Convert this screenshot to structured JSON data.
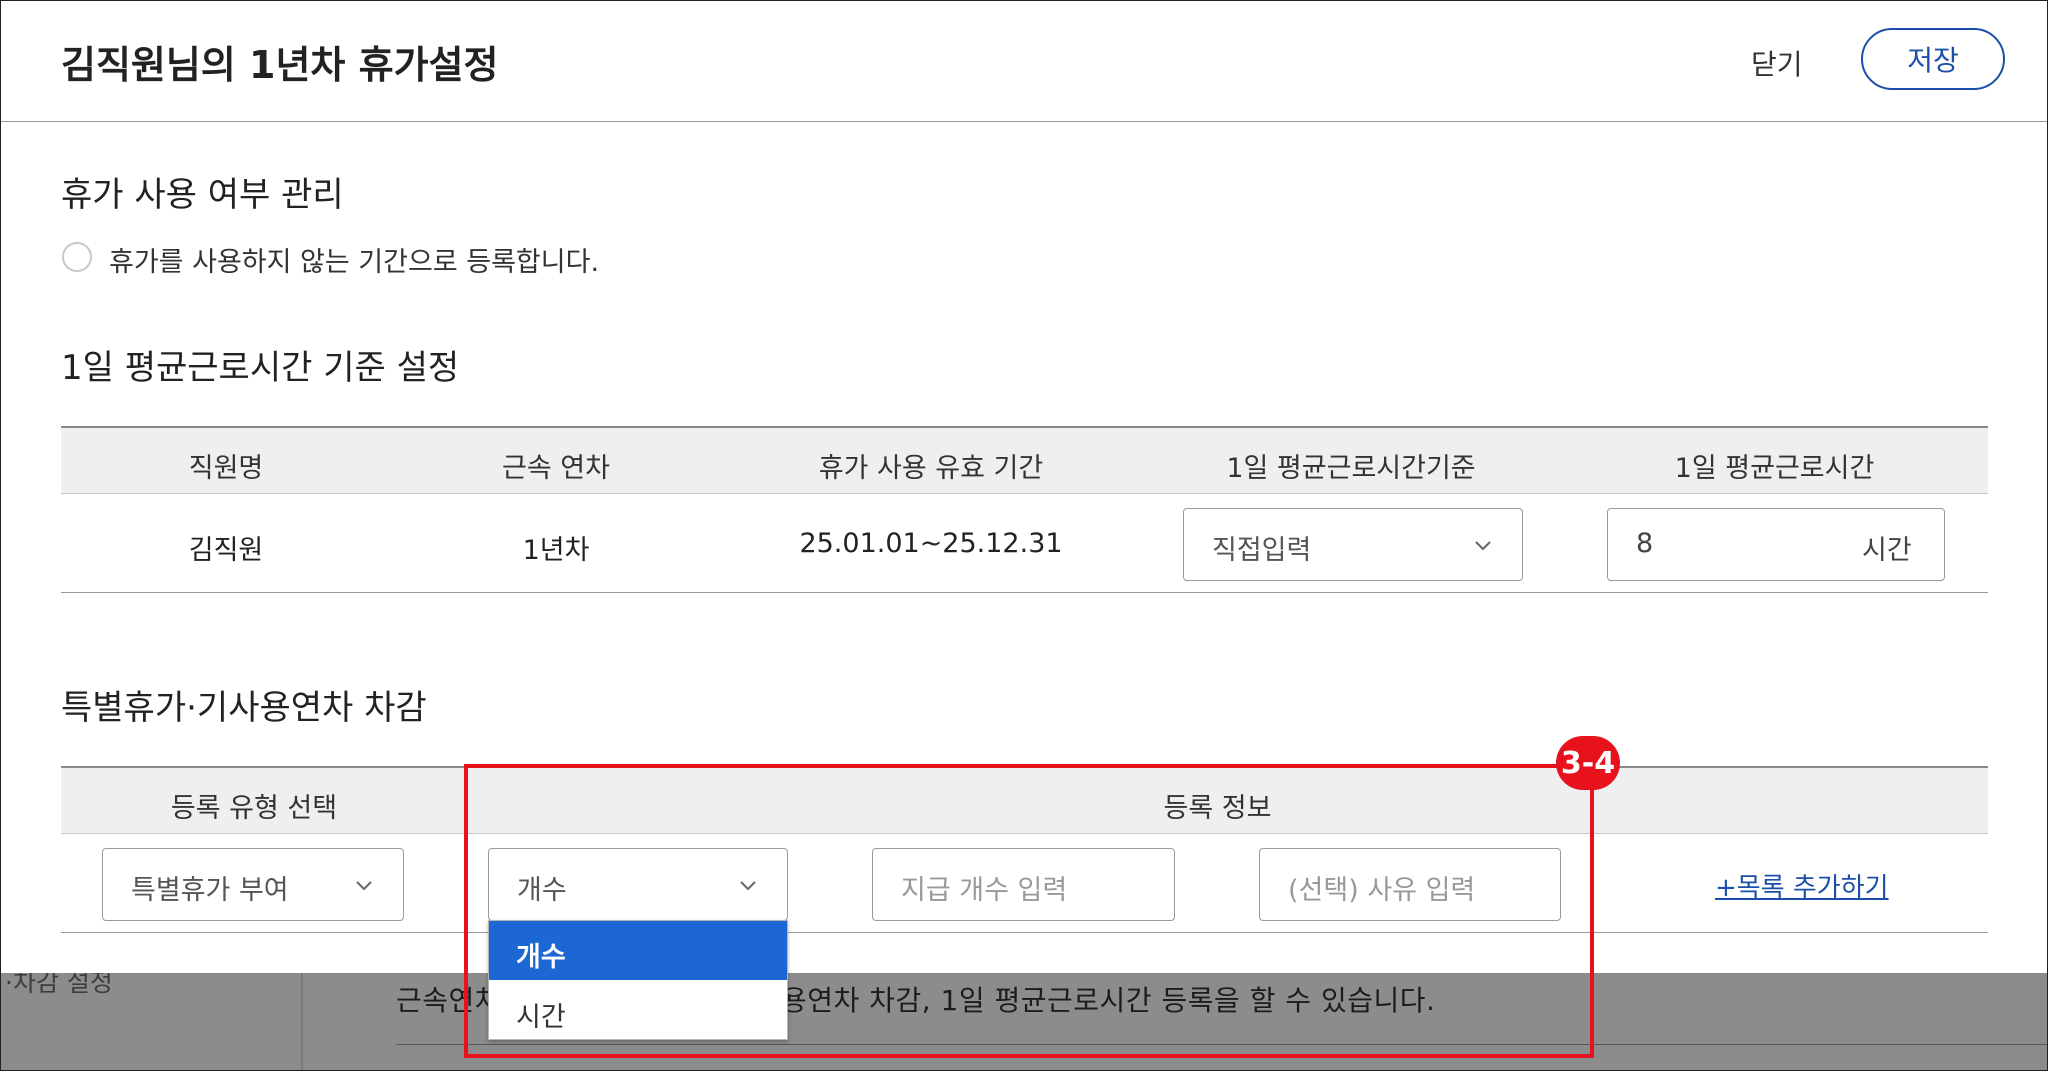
{
  "modal": {
    "title": "김직원님의 1년차 휴가설정",
    "close_label": "닫기",
    "save_label": "저장"
  },
  "usage_section": {
    "title": "휴가 사용 여부 관리",
    "radio_label": "휴가를 사용하지 않는 기간으로 등록합니다."
  },
  "avg_section": {
    "title": "1일 평균근로시간 기준 설정",
    "headers": [
      "직원명",
      "근속 연차",
      "휴가 사용 유효 기간",
      "1일 평균근로시간기준",
      "1일 평균근로시간"
    ],
    "row": {
      "name": "김직원",
      "tenure": "1년차",
      "period": "25.01.01~25.12.31",
      "basis_value": "직접입력",
      "hours_value": "8",
      "hours_unit": "시간"
    }
  },
  "special_section": {
    "title": "특별휴가·기사용연차 차감",
    "headers": [
      "등록 유형 선택",
      "등록 정보"
    ],
    "type_value": "특별휴가 부여",
    "unit_value": "개수",
    "count_placeholder": "지급 개수 입력",
    "reason_placeholder": "(선택) 사유 입력",
    "add_link": "+목록 추가하기",
    "dropdown_options": [
      "개수",
      "시간"
    ],
    "dropdown_selected": "개수"
  },
  "annotation": {
    "badge": "3-4",
    "color": "#e8121c"
  },
  "background_page": {
    "left_text": "·차감 설정",
    "main_text": "근속연차",
    "main_text_2": "용연차 차감, 1일 평균근로시간 등록을 할 수 있습니다."
  },
  "colors": {
    "accent": "#1c4fa8",
    "selected_option": "#1c67d4"
  }
}
